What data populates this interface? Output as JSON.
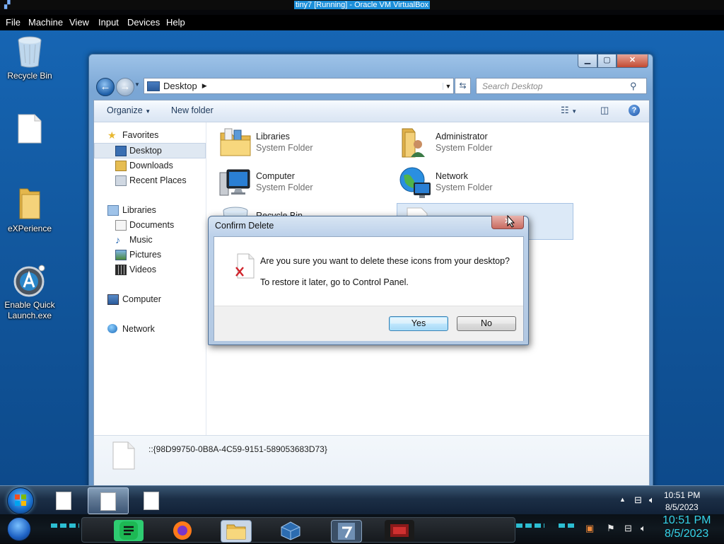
{
  "host": {
    "window_title": "tiny7 [Running] - Oracle VM VirtualBox",
    "menu": [
      "File",
      "Machine",
      "View",
      "Input",
      "Devices",
      "Help"
    ],
    "clock_time": "10:51 PM",
    "clock_date": "8/5/2023"
  },
  "desktop_icons": [
    {
      "label": "Recycle Bin",
      "icon": "recycle-bin-icon"
    },
    {
      "label": "",
      "icon": "blank-document-icon"
    },
    {
      "label": "eXPerience",
      "icon": "folder-icon"
    },
    {
      "label": "Enable Quick Launch.exe",
      "icon": "quick-launch-app-icon"
    }
  ],
  "explorer": {
    "address": "Desktop",
    "search_placeholder": "Search Desktop",
    "toolbar": {
      "organize": "Organize",
      "new_folder": "New folder"
    },
    "nav": {
      "favorites": "Favorites",
      "desktop": "Desktop",
      "downloads": "Downloads",
      "recent_places": "Recent Places",
      "libraries": "Libraries",
      "documents": "Documents",
      "music": "Music",
      "pictures": "Pictures",
      "videos": "Videos",
      "computer": "Computer",
      "network": "Network"
    },
    "items": [
      {
        "name": "Libraries",
        "sub": "System Folder",
        "icon": "libraries-icon"
      },
      {
        "name": "Administrator",
        "sub": "System Folder",
        "icon": "user-folder-icon"
      },
      {
        "name": "Computer",
        "sub": "System Folder",
        "icon": "computer-icon"
      },
      {
        "name": "Network",
        "sub": "System Folder",
        "icon": "network-icon"
      },
      {
        "name": "Recycle Bin",
        "sub": "",
        "icon": "recycle-bin-icon"
      }
    ],
    "details_name": "::{98D99750-0B8A-4C59-9151-589053683D73}"
  },
  "dialog": {
    "title": "Confirm Delete",
    "message": "Are you sure you want to delete these icons from your desktop?",
    "submessage": "To restore it later, go to Control Panel.",
    "yes": "Yes",
    "no": "No"
  },
  "taskbar": {
    "clock_time": "10:51 PM",
    "clock_date": "8/5/2023"
  },
  "colors": {
    "desktop_blue": "#1665b3",
    "window_frame": "#80aad7",
    "accent_cyan": "#35d3e8",
    "vbox_title_highlight": "#1c8fd9"
  }
}
